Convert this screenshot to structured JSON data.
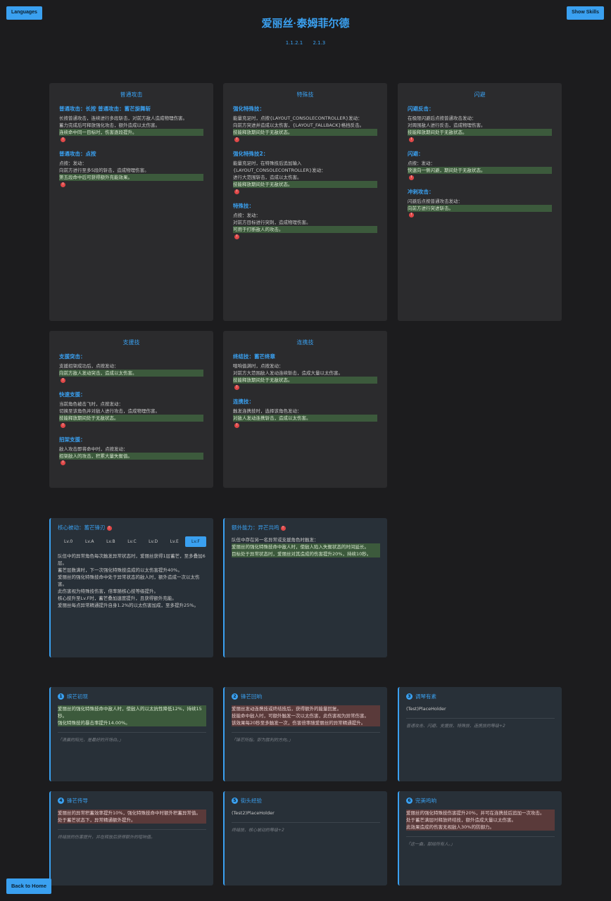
{
  "nav": {
    "languages": "Languages",
    "show_skills": "Show Skills",
    "back_home": "Back to Home"
  },
  "character": {
    "name": "爱丽丝·泰姆菲尔德",
    "versions": [
      "1.1.2.1",
      "2.1.3"
    ]
  },
  "skill_cards": [
    {
      "title": "普通攻击",
      "sections": [
        {
          "heading": "普通攻击：长按 普通攻击：蓄芒旋舞斩",
          "lines": [
            "长按普通攻击，连续进行多段斩击，对前方敌人造成物理伤害。",
            "蓄力完成后可释放强化攻击，额外造成以太伤害。",
            "连续命中同一目标时，伤害逐段提升。"
          ]
        },
        {
          "heading": "普通攻击：点按",
          "lines": [
            "点按：发动：",
            "向前方进行至多5段的斩击，造成物理伤害。",
            "第五段命中后可获得额外充能效果。"
          ]
        }
      ]
    },
    {
      "title": "特殊技",
      "sections": [
        {
          "heading": "强化特殊技：",
          "lines": [
            "能量充足时，点按{LAYOUT_CONSOLECONTROLLER}发动：",
            "向前方突进并造成以太伤害，{LAYOUT_FALLBACK}格挡反击。",
            "技能释放期间处于无敌状态。"
          ]
        },
        {
          "heading": "强化特殊技2：",
          "lines": [
            "能量充足时，在特殊技后追加输入{LAYOUT_CONSOLECONTROLLER}发动：",
            "进行大范围斩击，造成以太伤害。",
            "技能释放期间处于无敌状态。"
          ]
        },
        {
          "heading": "特殊技：",
          "lines": [
            "点按：发动：",
            "对前方目标进行突刺，造成物理伤害。",
            "可用于打断敌人的攻击。"
          ]
        }
      ]
    },
    {
      "title": "闪避",
      "sections": [
        {
          "heading": "闪避反击：",
          "lines": [
            "在极限闪避后点按普通攻击发动：",
            "对周围敌人进行反击，造成物理伤害。",
            "技能释放期间处于无敌状态。"
          ]
        },
        {
          "heading": "闪避：",
          "lines": [
            "点按：发动：",
            "快速向一侧闪避，期间处于无敌状态。"
          ]
        },
        {
          "heading": "冲刺攻击：",
          "lines": [
            "闪避后点按普通攻击发动：",
            "向前方进行突进斩击。"
          ]
        }
      ]
    },
    {
      "title": "支援技",
      "sections": [
        {
          "heading": "支援突击：",
          "lines": [
            "支援招架成功后，点按发动：",
            "向前方敌人发动突击，造成以太伤害。"
          ]
        },
        {
          "heading": "快速支援：",
          "lines": [
            "当前角色被击飞时，点按发动：",
            "切换至该角色并对敌人进行攻击，造成物理伤害。",
            "技能释放期间处于无敌状态。"
          ]
        },
        {
          "heading": "招架支援：",
          "lines": [
            "敌人攻击即将命中时，点按发动：",
            "招架敌人的攻击，积累大量失衡值。"
          ]
        }
      ]
    },
    {
      "title": "连携技",
      "sections": [
        {
          "heading": "终结技：蓄芒终章",
          "lines": [
            "喧响值满时，点按发动：",
            "对前方大范围敌人发动连续斩击，造成大量以太伤害。",
            "技能释放期间处于无敌状态。"
          ]
        },
        {
          "heading": "连携技：",
          "lines": [
            "触发连携技时，选择该角色发动：",
            "对敌人发动连携斩击，造成以太伤害。"
          ]
        }
      ]
    }
  ],
  "core": {
    "title": "核心被动：蓄芒锋刃",
    "levels": [
      "Lv.0",
      "Lv.A",
      "Lv.B",
      "Lv.C",
      "Lv.D",
      "Lv.E",
      "Lv.F"
    ],
    "active_level": "Lv.F",
    "lines": [
      "队伍中的异常角色每次触发异常状态时，爱丽丝获得1层蓄芒，至多叠加6层。",
      "蓄芒层数满时，下一次强化特殊技造成的以太伤害提升40%。",
      "爱丽丝的强化特殊技命中处于异常状态的敌人时，额外造成一次以太伤害。",
      "此伤害视为特殊技伤害，倍率随核心技等级提升。",
      "核心技升至Lv.F时，蓄芒叠加速度提升，且获得额外充能。",
      "爱丽丝每点异常精通提升自身1.2%的以太伤害加成，至多提升25%。"
    ]
  },
  "extra": {
    "title": "额外能力：异芒共鸣",
    "lines": [
      "队伍中存在另一名异常或支援角色时触发：",
      "爱丽丝的强化特殊技命中敌人时，使敌人陷入失衡状态的时间延长。",
      "目标处于异常状态时，爱丽丝对其造成的伤害提升20%，持续10秒。"
    ]
  },
  "mindscapes": [
    {
      "num": "1",
      "title": "缤芒初现",
      "lines": [
        "爱丽丝的强化特殊技命中敌人时，使敌人的以太抗性降低12%，持续15秒。",
        "强化特殊技的暴击率提升14.00%。"
      ],
      "quote": "「清晨的阳光，是最好的开场白。」"
    },
    {
      "num": "2",
      "title": "锋芒回响",
      "lines": [
        "爱丽丝发动连携技或终结技后，获得额外的能量回复。",
        "技能命中敌人时，可额外触发一次以太伤害，此伤害视为异常伤害。",
        "该效果每20秒至多触发一次，伤害倍率随爱丽丝的异常精通提升。"
      ],
      "quote": "「锋芒所指，即为胜利的方向。」"
    },
    {
      "num": "3",
      "title": "调琴有素",
      "lines": [
        "(Test)PlaceHolder"
      ],
      "quote": "普通攻击、闪避、支援技、特殊技、连携技的等级+2"
    },
    {
      "num": "4",
      "title": "锋芒传导",
      "lines": [
        "爱丽丝的异常积蓄效率提升10%，强化特殊技命中时额外积蓄异常值。",
        "处于蓄芒状态下，异常精通额外提升。"
      ],
      "quote": "终结技的伤害提升，并在释放后获得额外的喧响值。"
    },
    {
      "num": "5",
      "title": "街头经验",
      "lines": [
        "(Test2)PlaceHolder"
      ],
      "quote": "终结技、核心被动的等级+2"
    },
    {
      "num": "6",
      "title": "完美鸣响",
      "lines": [
        "爱丽丝的强化特殊技伤害提升20%，并可在连携技后追加一次攻击。",
        "处于蓄芒满层时释放终结技，额外造成大量以太伤害。",
        "此效果造成的伤害无视敌人30%的防御力。"
      ],
      "quote": "「这一曲，献给所有人。」"
    }
  ],
  "colors": {
    "accent": "#3aa0f0",
    "bg": "#1c1c1e",
    "card": "#2b2b2d",
    "card_alt": "#283038"
  }
}
